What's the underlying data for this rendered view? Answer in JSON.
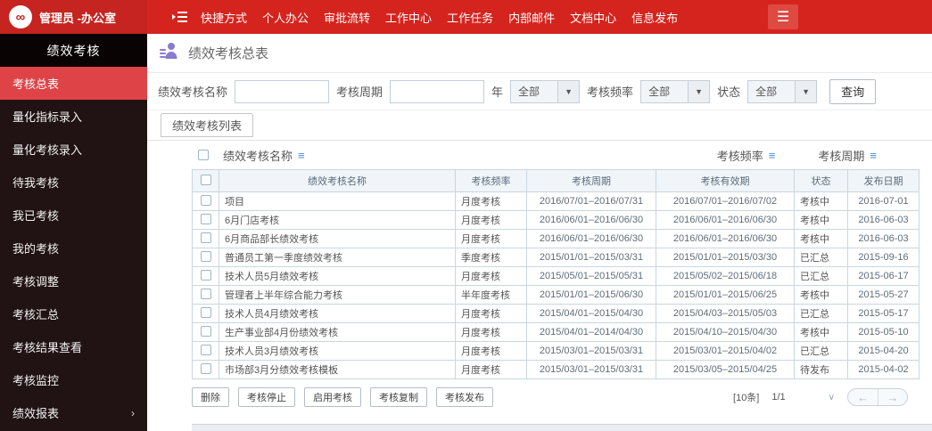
{
  "topbar": {
    "user": "管理员 -办公室",
    "nav": [
      "快捷方式",
      "个人办公",
      "审批流转",
      "工作中心",
      "工作任务",
      "内部邮件",
      "文档中心",
      "信息发布"
    ]
  },
  "sidebar": {
    "header": "绩效考核",
    "items": [
      {
        "label": "考核总表",
        "active": true
      },
      {
        "label": "量化指标录入"
      },
      {
        "label": "量化考核录入"
      },
      {
        "label": "待我考核"
      },
      {
        "label": "我已考核"
      },
      {
        "label": "我的考核"
      },
      {
        "label": "考核调整"
      },
      {
        "label": "考核汇总"
      },
      {
        "label": "考核结果查看"
      },
      {
        "label": "考核监控"
      },
      {
        "label": "绩效报表",
        "has_children": true
      }
    ]
  },
  "page": {
    "title": "绩效考核总表"
  },
  "filters": {
    "name_label": "绩效考核名称",
    "name_value": "",
    "period_label": "考核周期",
    "period_value": "",
    "year_suffix": "年",
    "year_value": "全部",
    "freq_label": "考核频率",
    "freq_value": "全部",
    "status_label": "状态",
    "status_value": "全部",
    "search_button": "查询"
  },
  "list_tab": "绩效考核列表",
  "sort_bar": {
    "name": "绩效考核名称",
    "freq": "考核频率",
    "period": "考核周期"
  },
  "table": {
    "headers": [
      "绩效考核名称",
      "考核频率",
      "考核周期",
      "考核有效期",
      "状态",
      "发布日期"
    ],
    "rows": [
      {
        "name": "项目",
        "freq": "月度考核",
        "period": "2016/07/01–2016/07/31",
        "validity": "2016/07/01–2016/07/02",
        "status": "考核中",
        "date": "2016-07-01"
      },
      {
        "name": "6月门店考核",
        "freq": "月度考核",
        "period": "2016/06/01–2016/06/30",
        "validity": "2016/06/01–2016/06/30",
        "status": "考核中",
        "date": "2016-06-03"
      },
      {
        "name": "6月商品部长绩效考核",
        "freq": "月度考核",
        "period": "2016/06/01–2016/06/30",
        "validity": "2016/06/01–2016/06/30",
        "status": "考核中",
        "date": "2016-06-03"
      },
      {
        "name": "普通员工第一季度绩效考核",
        "freq": "季度考核",
        "period": "2015/01/01–2015/03/31",
        "validity": "2015/01/01–2015/03/30",
        "status": "已汇总",
        "date": "2015-09-16"
      },
      {
        "name": "技术人员5月绩效考核",
        "freq": "月度考核",
        "period": "2015/05/01–2015/05/31",
        "validity": "2015/05/02–2015/06/18",
        "status": "已汇总",
        "date": "2015-06-17"
      },
      {
        "name": "管理者上半年综合能力考核",
        "freq": "半年度考核",
        "period": "2015/01/01–2015/06/30",
        "validity": "2015/01/01–2015/06/25",
        "status": "考核中",
        "date": "2015-05-27"
      },
      {
        "name": "技术人员4月绩效考核",
        "freq": "月度考核",
        "period": "2015/04/01–2015/04/30",
        "validity": "2015/04/03–2015/05/03",
        "status": "已汇总",
        "date": "2015-05-17"
      },
      {
        "name": "生产事业部4月份绩效考核",
        "freq": "月度考核",
        "period": "2015/04/01–2014/04/30",
        "validity": "2015/04/10–2015/04/30",
        "status": "考核中",
        "date": "2015-05-10"
      },
      {
        "name": "技术人员3月绩效考核",
        "freq": "月度考核",
        "period": "2015/03/01–2015/03/31",
        "validity": "2015/03/01–2015/04/02",
        "status": "已汇总",
        "date": "2015-04-20"
      },
      {
        "name": "市场部3月分绩效考核模板",
        "freq": "月度考核",
        "period": "2015/03/01–2015/03/31",
        "validity": "2015/03/05–2015/04/25",
        "status": "待发布",
        "date": "2015-04-02"
      }
    ]
  },
  "actions": [
    "删除",
    "考核停止",
    "启用考核",
    "考核复制",
    "考核发布"
  ],
  "pagination": {
    "count": "[10条]",
    "page": "1/1"
  }
}
